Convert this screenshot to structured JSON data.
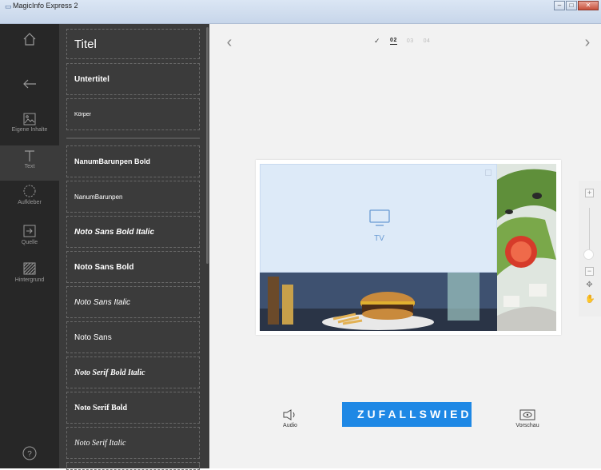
{
  "window": {
    "title": "MagicInfo Express 2",
    "app_icon": "magicinfo-app-icon"
  },
  "rail": {
    "home_icon": "home-icon",
    "back_icon": "back-arrow-icon",
    "items": [
      {
        "label": "Eigene Inhalte",
        "icon": "image-icon"
      },
      {
        "label": "Text",
        "icon": "text-icon"
      },
      {
        "label": "Aufkleber",
        "icon": "sticker-icon"
      },
      {
        "label": "Quelle",
        "icon": "source-icon"
      },
      {
        "label": "Hintergrund",
        "icon": "background-icon"
      }
    ],
    "help": "?"
  },
  "fonts": {
    "presets": [
      {
        "label": "Titel"
      },
      {
        "label": "Untertitel"
      },
      {
        "label": "Körper"
      }
    ],
    "families": [
      {
        "label": "NanumBarunpen Bold"
      },
      {
        "label": "NanumBarunpen"
      },
      {
        "label": "Noto Sans Bold Italic"
      },
      {
        "label": "Noto Sans Bold"
      },
      {
        "label": "Noto Sans Italic"
      },
      {
        "label": "Noto Sans"
      },
      {
        "label": "Noto Serif Bold Italic"
      },
      {
        "label": "Noto Serif Bold"
      },
      {
        "label": "Noto Serif Italic"
      }
    ]
  },
  "pages": {
    "done": "✓",
    "current": "02",
    "p3": "03",
    "p4": "04"
  },
  "canvas": {
    "tv_label": "TV"
  },
  "zoom": {
    "plus": "+",
    "minus": "−"
  },
  "bottom": {
    "audio": "Audio",
    "random": "ZUFALLSWIEDERGABE",
    "preview": "Vorschau"
  },
  "colors": {
    "accent": "#1e88e5",
    "tv_zone": "#ddeaf8",
    "rail": "#272727",
    "panel": "#3b3b3b"
  }
}
